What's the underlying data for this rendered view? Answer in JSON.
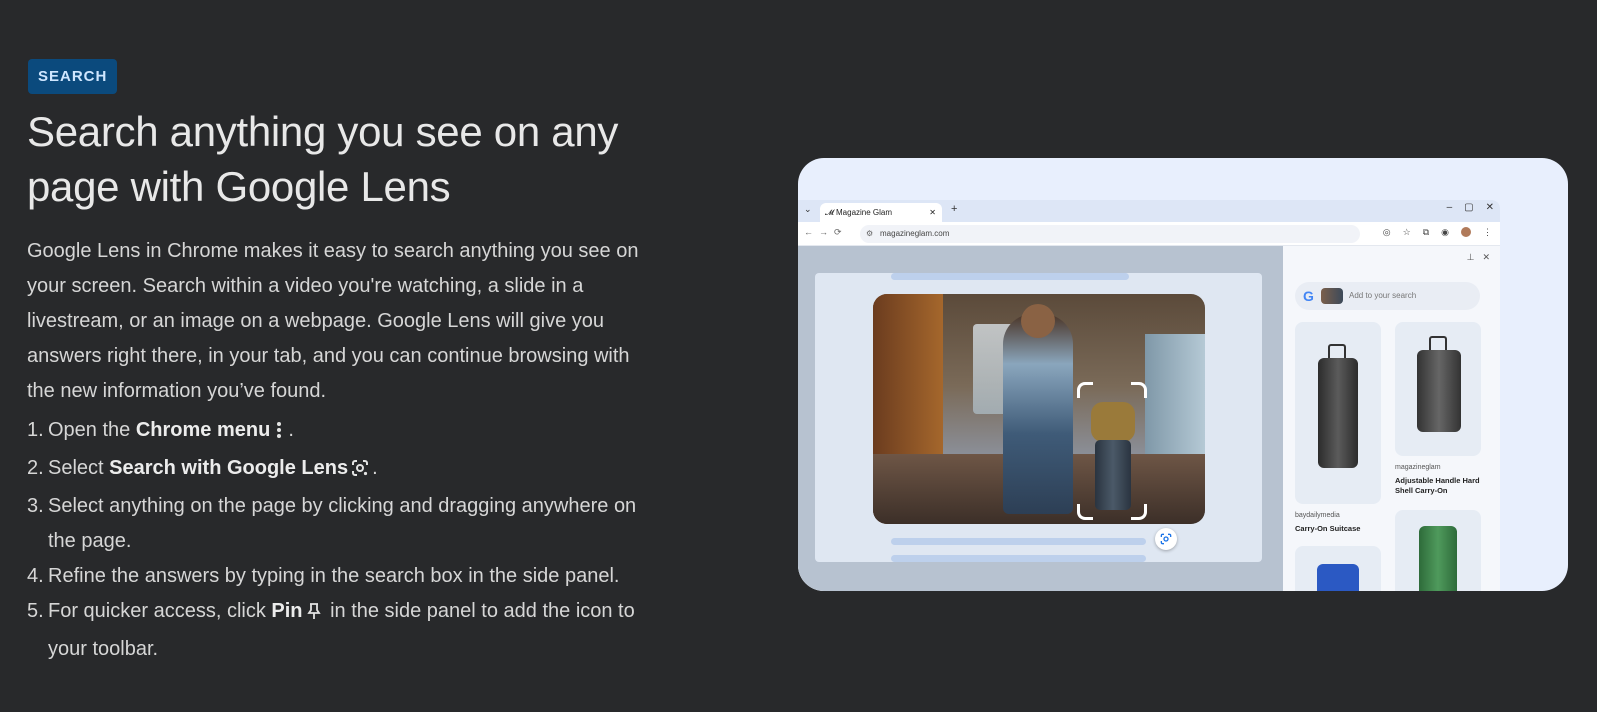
{
  "badge": "SEARCH",
  "title": "Search anything you see on any page with Google Lens",
  "intro": "Google Lens in Chrome makes it easy to search anything you see on your screen. Search within a video you're watching, a slide in a livestream, or an image on a webpage. Google Lens will give you answers right there, in your tab, and you can continue browsing with the new information you’ve found.",
  "steps": [
    {
      "num": "1.",
      "pre": "Open the ",
      "bold": "Chrome menu",
      "icon": "more-vert-icon",
      "post": "."
    },
    {
      "num": "2.",
      "pre": "Select ",
      "bold": "Search with Google Lens",
      "icon": "lens-icon",
      "post": "."
    },
    {
      "num": "3.",
      "text": "Select anything on the page by clicking and dragging anywhere on the page."
    },
    {
      "num": "4.",
      "text": "Refine the answers by typing in the search box in the side panel."
    },
    {
      "num": "5.",
      "pre": "For quicker access, click ",
      "bold": "Pin",
      "icon": "pin-icon",
      "post": " in the side panel to add the icon to your toolbar."
    }
  ],
  "illustration": {
    "tab_title": "Magazine Glam",
    "url": "magazineglam.com",
    "side_panel": {
      "search_placeholder": "Add to your search",
      "results": [
        {
          "source": "baydailymedia",
          "title": "Carry-On Suitcase"
        },
        {
          "source": "magazineglam",
          "title": "Adjustable Handle Hard Shell Carry-On"
        }
      ]
    }
  }
}
